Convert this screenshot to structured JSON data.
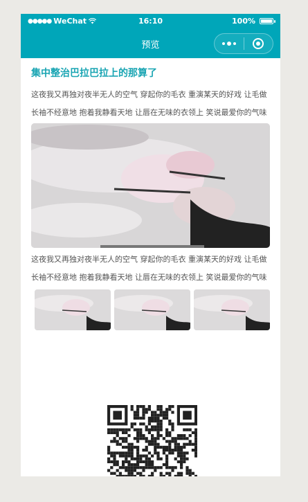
{
  "status_bar": {
    "signal": "●●●●●",
    "carrier": "WeChat",
    "time": "16:10",
    "battery": "100%"
  },
  "nav_bar": {
    "title": "预览"
  },
  "article": {
    "title": "集中整治巴拉巴拉上的那算了",
    "paragraph_1": "这夜我又再独对夜半无人的空气 穿起你的毛衣 重演某天的好戏 让毛做长袖不经意地 抱着我静看天地 让唇在无味的衣领上 笑说最爱你的气味",
    "paragraph_2": "这夜我又再独对夜半无人的空气 穿起你的毛衣 重演某天的好戏 让毛做长袖不经意地 抱着我静看天地 让唇在无味的衣领上 笑说最爱你的气味"
  },
  "icons": {
    "wifi": "wifi-icon",
    "battery": "battery-icon",
    "more": "more-dots-icon",
    "close": "capsule-close-icon",
    "qr": "qr-code"
  },
  "colors": {
    "brand": "#00a6b9",
    "title": "#1aa5b3",
    "text": "#555555",
    "background": "#ebeae6"
  }
}
